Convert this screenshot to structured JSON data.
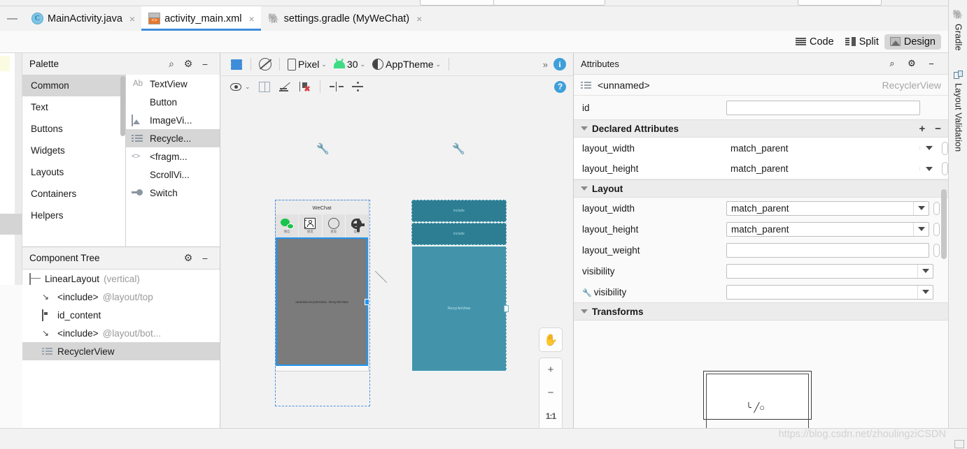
{
  "window": {
    "collapse_icon": "minimize-icon"
  },
  "tabs": [
    {
      "label": "MainActivity.java",
      "icon": "java-class-icon",
      "active": false,
      "close": "×"
    },
    {
      "label": "activity_main.xml",
      "icon": "android-layout-xml-icon",
      "active": true,
      "close": "×"
    },
    {
      "label": "settings.gradle (MyWeChat)",
      "icon": "gradle-elephant-icon",
      "active": false,
      "close": "×"
    }
  ],
  "editor_modes": [
    {
      "label": "Code",
      "icon": "code-lines-icon",
      "selected": false
    },
    {
      "label": "Split",
      "icon": "split-view-icon",
      "selected": false
    },
    {
      "label": "Design",
      "icon": "design-preview-icon",
      "selected": true
    }
  ],
  "palette": {
    "title": "Palette",
    "actions": [
      {
        "name": "search-icon",
        "glyph": "⌕"
      },
      {
        "name": "gear-icon",
        "glyph": "⚙"
      },
      {
        "name": "minimize-icon",
        "glyph": "−"
      }
    ],
    "categories": [
      {
        "label": "Common",
        "selected": true
      },
      {
        "label": "Text",
        "selected": false
      },
      {
        "label": "Buttons",
        "selected": false
      },
      {
        "label": "Widgets",
        "selected": false
      },
      {
        "label": "Layouts",
        "selected": false
      },
      {
        "label": "Containers",
        "selected": false
      },
      {
        "label": "Helpers",
        "selected": false
      }
    ],
    "widgets": [
      {
        "label": "TextView",
        "icon": "textview-icon",
        "selected": false
      },
      {
        "label": "Button",
        "icon": "button-icon",
        "selected": false
      },
      {
        "label": "ImageVi...",
        "icon": "imageview-icon",
        "selected": false
      },
      {
        "label": "Recycle...",
        "icon": "recyclerview-icon",
        "selected": true
      },
      {
        "label": "<fragm...",
        "icon": "fragment-icon",
        "selected": false
      },
      {
        "label": "ScrollVi...",
        "icon": "scrollview-icon",
        "selected": false
      },
      {
        "label": "Switch",
        "icon": "switch-icon",
        "selected": false
      }
    ]
  },
  "component_tree": {
    "title": "Component Tree",
    "actions": [
      {
        "name": "gear-icon",
        "glyph": "⚙"
      },
      {
        "name": "minimize-icon",
        "glyph": "−"
      }
    ],
    "nodes": [
      {
        "label": "LinearLayout",
        "sub": "(vertical)",
        "icon": "linearlayout-icon",
        "indent": 0,
        "selected": false
      },
      {
        "label": "<include>",
        "sub": "@layout/top",
        "icon": "include-arrow-icon",
        "indent": 1,
        "selected": false
      },
      {
        "label": "id_content",
        "sub": "",
        "icon": "framelayout-icon",
        "indent": 1,
        "selected": false
      },
      {
        "label": "<include>",
        "sub": "@layout/bot...",
        "icon": "include-arrow-icon",
        "indent": 1,
        "selected": false
      },
      {
        "label": "RecyclerView",
        "sub": "",
        "icon": "recyclerview-icon",
        "indent": 1,
        "selected": true
      }
    ]
  },
  "design_toolbar": {
    "layers_icon": "layers-icon",
    "orientation_icon": "rotate-orientation-icon",
    "device": {
      "label": "Pixel",
      "icon": "phone-icon",
      "caret": "⌄"
    },
    "api": {
      "label": "30",
      "icon": "android-robot-icon",
      "caret": "⌄"
    },
    "theme": {
      "label": "AppTheme",
      "icon": "theme-contrast-icon",
      "caret": "⌄"
    },
    "overflow": "»",
    "info_icon": "info-icon",
    "row2": [
      {
        "name": "view-options-icon",
        "label": ""
      },
      {
        "name": "blueprint-columns-icon",
        "label": ""
      },
      {
        "name": "toggle-magnets-off-icon",
        "label": ""
      },
      {
        "name": "clear-constraints-icon",
        "label": ""
      },
      {
        "name": "horizontal-margin-icon",
        "label": ""
      },
      {
        "name": "vertical-margin-icon",
        "label": ""
      }
    ],
    "help_icon": "help-icon"
  },
  "canvas": {
    "rendered_device": {
      "app_title": "WeChat",
      "tabs": [
        {
          "label": "微信",
          "icon": "wechat-chat-icon"
        },
        {
          "label": "朋友",
          "icon": "contacts-icon"
        },
        {
          "label": "发现",
          "icon": "discover-compass-icon"
        },
        {
          "label": "设置",
          "icon": "settings-gear-icon"
        }
      ],
      "recyclerview_label": "androidx.recyclerview...RecyclerView"
    },
    "blueprint": {
      "band1_label": "include",
      "band2_label": "include",
      "body_label": "RecyclerView"
    },
    "zoom_tools": [
      {
        "name": "pan-tool-button",
        "glyph": "✋"
      },
      {
        "name": "zoom-in-button",
        "glyph": "+"
      },
      {
        "name": "zoom-out-button",
        "glyph": "−"
      },
      {
        "name": "zoom-actual-size-button",
        "glyph": "1:1"
      },
      {
        "name": "zoom-to-fit-button",
        "glyph": ""
      }
    ]
  },
  "attributes": {
    "title": "Attributes",
    "actions": [
      {
        "name": "search-icon",
        "glyph": "⌕"
      },
      {
        "name": "gear-icon",
        "glyph": "⚙"
      },
      {
        "name": "minimize-icon",
        "glyph": "−"
      }
    ],
    "selected": {
      "icon": "recyclerview-icon",
      "name": "<unnamed>",
      "class": "RecyclerView"
    },
    "id_row": {
      "label": "id",
      "value": ""
    },
    "declared_section": {
      "title": "Declared Attributes",
      "add": "+",
      "remove": "−",
      "rows": [
        {
          "label": "layout_width",
          "value": "match_parent"
        },
        {
          "label": "layout_height",
          "value": "match_parent"
        }
      ]
    },
    "layout_section": {
      "title": "Layout",
      "rows": [
        {
          "label": "layout_width",
          "value": "match_parent",
          "dropdown": true,
          "pill": true,
          "wrench": false
        },
        {
          "label": "layout_height",
          "value": "match_parent",
          "dropdown": true,
          "pill": true,
          "wrench": false
        },
        {
          "label": "layout_weight",
          "value": "",
          "dropdown": false,
          "pill": true,
          "wrench": false
        },
        {
          "label": "visibility",
          "value": "",
          "dropdown": true,
          "pill": false,
          "wrench": false
        },
        {
          "label": "visibility",
          "value": "",
          "dropdown": true,
          "pill": false,
          "wrench": true
        }
      ]
    },
    "transforms_section": {
      "title": "Transforms"
    }
  },
  "right_tabs": [
    {
      "label": "Gradle",
      "icon": "gradle-elephant-icon"
    },
    {
      "label": "Layout Validation",
      "icon": "layout-validation-icon"
    }
  ],
  "watermark": "https://blog.csdn.net/zhoulingziCSDN",
  "colors": {
    "accent": "#3f8cd9",
    "selection": "#d6d6d6",
    "blueprint": "#4394ab",
    "wechat_green": "#18c44c"
  }
}
